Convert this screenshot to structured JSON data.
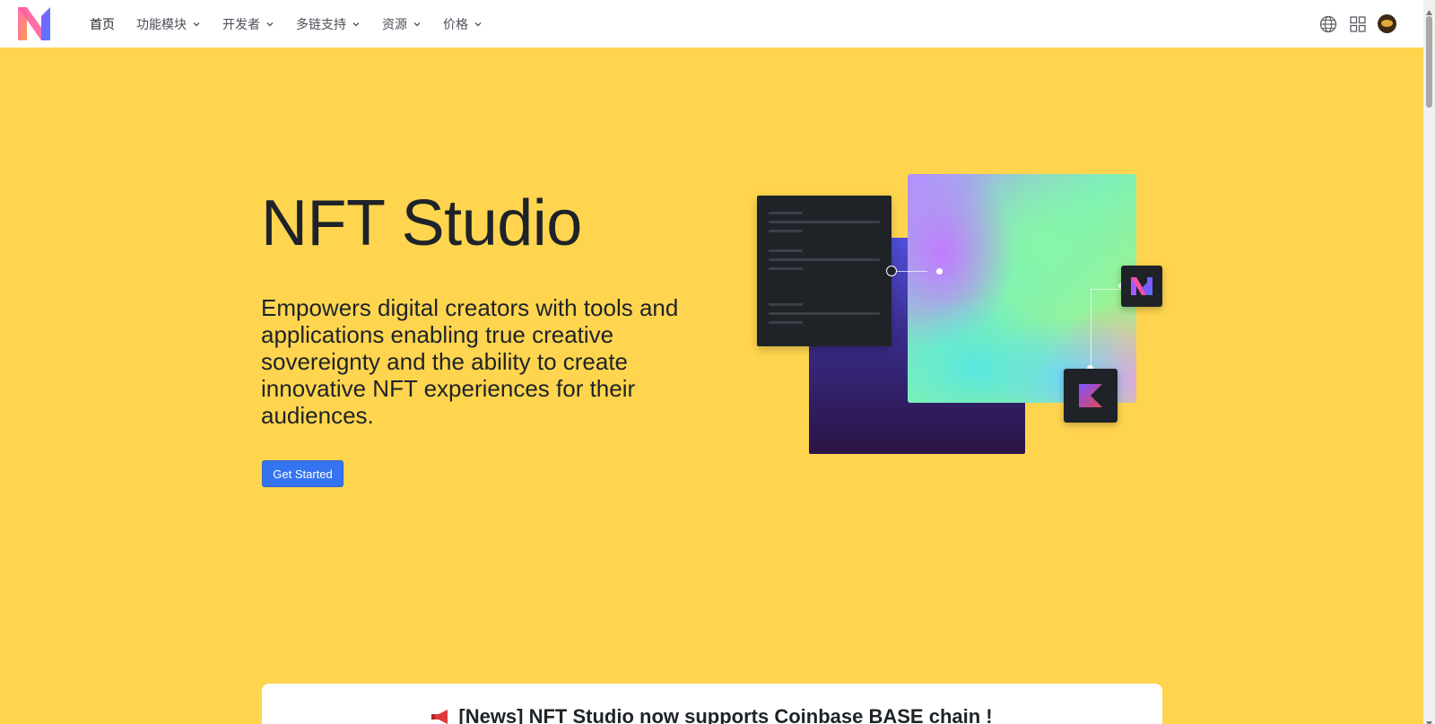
{
  "nav": {
    "items": [
      {
        "label": "首页",
        "dropdown": false,
        "active": true
      },
      {
        "label": "功能模块",
        "dropdown": true
      },
      {
        "label": "开发者",
        "dropdown": true
      },
      {
        "label": "多链支持",
        "dropdown": true
      },
      {
        "label": "资源",
        "dropdown": true
      },
      {
        "label": "价格",
        "dropdown": true
      }
    ],
    "right_icons": [
      "globe-icon",
      "grid-icon",
      "avatar"
    ]
  },
  "hero": {
    "title": "NFT Studio",
    "description": "Empowers digital creators with tools and applications enabling true creative sovereignty and the ability to create innovative NFT experiences for their audiences.",
    "cta_label": "Get Started"
  },
  "news": {
    "text": "[News] NFT Studio now supports Coinbase BASE chain !",
    "icon": "megaphone-icon"
  },
  "colors": {
    "hero_bg": "#ffd54f",
    "cta_bg": "#3574f0",
    "nav_bg": "#ffffff"
  }
}
